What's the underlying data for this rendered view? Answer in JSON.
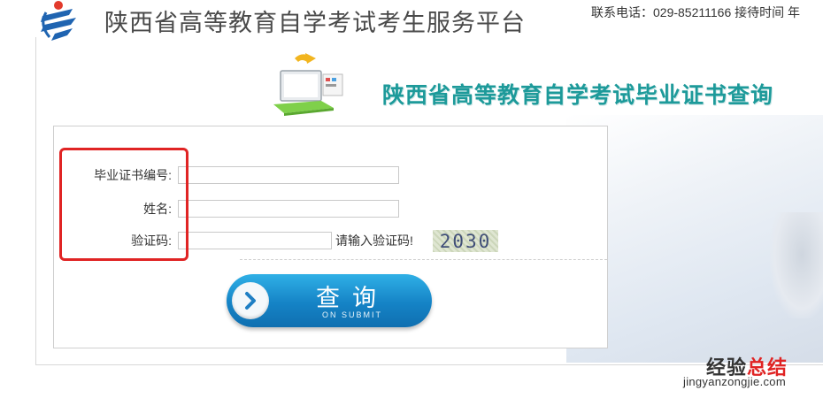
{
  "header": {
    "site_title": "陕西省高等教育自学考试考生服务平台",
    "contact": "联系电话：029-85211166  接待时间  年"
  },
  "banner": {
    "title": "陕西省高等教育自学考试毕业证书查询"
  },
  "form": {
    "certificate_label": "毕业证书编号:",
    "certificate_value": "",
    "name_label": "姓名:",
    "name_value": "",
    "captcha_label": "验证码:",
    "captcha_value": "",
    "captcha_hint": "请输入验证码!",
    "captcha_code": "2030"
  },
  "submit": {
    "label": "查询",
    "sub_label": "ON SUBMIT"
  },
  "watermark": {
    "text_a": "经验",
    "text_b": "总结",
    "url": "jingyanzongjie.com"
  },
  "colors": {
    "banner_title": "#1d9a9a",
    "highlight": "#e02424",
    "button": "#1583c6"
  },
  "icons": {
    "logo": "province-logo-icon",
    "banner": "laptop-icon",
    "submit": "arrow-right-icon"
  }
}
